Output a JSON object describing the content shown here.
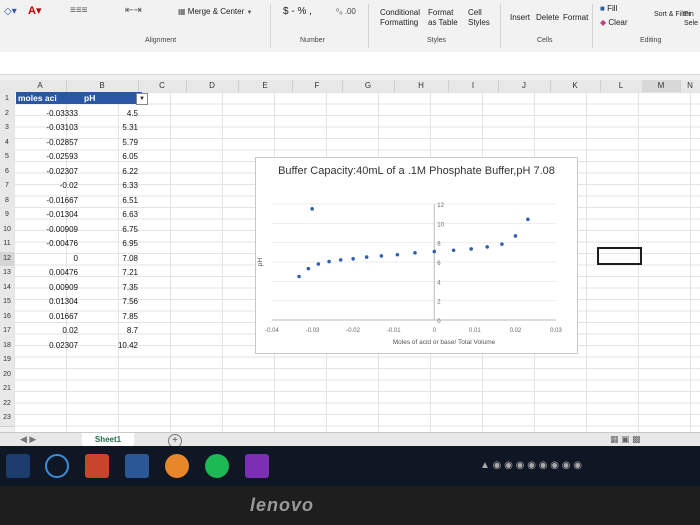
{
  "ribbon": {
    "merge_center": "Merge & Center",
    "currency": "$ - % ,",
    "decimals": "⁰₀ .00",
    "conditional_formatting": "Conditional Formatting",
    "format_as_table": "Format as Table",
    "cell_styles": "Cell Styles",
    "insert": "Insert",
    "delete": "Delete",
    "format": "Format",
    "fill": "Fill",
    "clear": "Clear",
    "sort_filter": "Sort & Filter",
    "find_select": "Fin Sele",
    "group_alignment": "Alignment",
    "group_number": "Number",
    "group_styles": "Styles",
    "group_cells": "Cells",
    "group_editing": "Editing"
  },
  "columns": [
    "A",
    "B",
    "C",
    "D",
    "E",
    "F",
    "G",
    "H",
    "I",
    "J",
    "K",
    "L",
    "M",
    "N"
  ],
  "rows": [
    "1",
    "2",
    "3",
    "4",
    "5",
    "6",
    "7",
    "8",
    "9",
    "10",
    "11",
    "12",
    "13",
    "14",
    "15",
    "16",
    "17",
    "18",
    "19",
    "20",
    "21",
    "22",
    "23"
  ],
  "table": {
    "header_a": "moles aci",
    "header_b": "pH",
    "col_a": [
      "-0.03333",
      "-0.03103",
      "-0.02857",
      "-0.02593",
      "-0.02307",
      "-0.02",
      "-0.01667",
      "-0.01304",
      "-0.00909",
      "-0.00476",
      "0",
      "0.00476",
      "0.00909",
      "0.01304",
      "0.01667",
      "0.02",
      "0.02307"
    ],
    "col_b": [
      "4.5",
      "5.31",
      "5.79",
      "6.05",
      "6.22",
      "6.33",
      "6.51",
      "6.63",
      "6.75",
      "6.95",
      "7.08",
      "7.21",
      "7.35",
      "7.56",
      "7.85",
      "8.7",
      "10.42"
    ]
  },
  "sheet_tab": "Sheet1",
  "brand": "lenovo",
  "chart_data": {
    "type": "scatter",
    "title": "Buffer Capacity:40mL of a .1M Phosphate Buffer,pH 7.08",
    "xlabel": "Moles of acid or base/ Total Volume",
    "ylabel": "pH",
    "xlim": [
      -0.04,
      0.03
    ],
    "ylim": [
      0,
      12
    ],
    "x_ticks": [
      "-0.04",
      "-0.03",
      "-0.02",
      "-0.01",
      "0",
      "0.01",
      "0.02",
      "0.03"
    ],
    "y_ticks": [
      "0",
      "2",
      "4",
      "6",
      "8",
      "10",
      "12"
    ],
    "series": [
      {
        "x": [
          -0.03333,
          -0.03103,
          -0.02857,
          -0.02593,
          -0.02307,
          -0.02,
          -0.01667,
          -0.01304,
          -0.00909,
          -0.00476,
          0,
          0.00476,
          0.00909,
          0.01304,
          0.01667,
          0.02,
          0.02307,
          -0.0301
        ],
        "y": [
          4.5,
          5.31,
          5.79,
          6.05,
          6.22,
          6.33,
          6.51,
          6.63,
          6.75,
          6.95,
          7.08,
          7.21,
          7.35,
          7.56,
          7.85,
          8.7,
          10.42,
          11.5
        ]
      }
    ],
    "marker_color": "#2f5fb3"
  }
}
